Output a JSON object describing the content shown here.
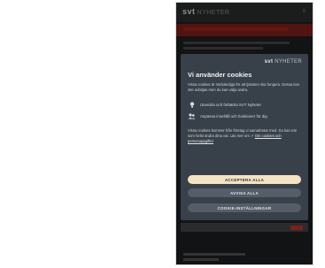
{
  "header": {
    "logo": "svt",
    "logo_sub": "NYHETER",
    "menu_label": "≡"
  },
  "modal": {
    "brand": "svt",
    "brand_sub": "NYHETER",
    "title": "Vi använder cookies",
    "intro": "Vissa cookies är nödvändiga för att tjänsten ska fungera. Dessa kan inte avböjas men du kan välja andra.",
    "features": [
      {
        "icon": "lightbulb-icon",
        "text": "Utveckla och förbättra SVT Nyheter"
      },
      {
        "icon": "people-icon",
        "text": "Anpassa innehåll och funktioner för dig"
      }
    ],
    "body": "Vissa cookies kommer från företag vi samarbetar med. Du kan när som helst ändra dina val. Läs mer om",
    "link_label": "Om cookies och personuppgifter",
    "buttons": {
      "accept_all": "ACCEPTERA ALLA",
      "reject_all": "AVVISA ALLA",
      "settings": "COOKIE-INSTÄLLNINGAR"
    }
  },
  "colors": {
    "modal_bg": "#38404a",
    "accept_bg": "#f4e3c3",
    "secondary_bg": "#545d68",
    "brand_red": "#7d1f1a"
  }
}
